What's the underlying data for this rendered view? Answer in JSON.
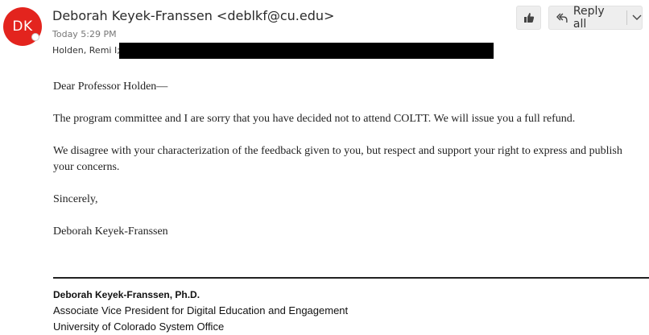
{
  "header": {
    "avatar_initials": "DK",
    "sender": "Deborah Keyek-Franssen <deblkf@cu.edu>",
    "timestamp": "Today 5:29 PM",
    "recipients": "Holden, Remi I;",
    "avatar_color": "#e3241e"
  },
  "actions": {
    "like_icon": "thumbs-up-icon",
    "reply_all_label": "Reply all",
    "reply_all_icon": "reply-all-icon",
    "dropdown_icon": "chevron-down-icon"
  },
  "message": {
    "greeting": "Dear Professor Holden—",
    "paragraph_1": "The program committee and I are sorry that you have decided not to attend COLTT. We will issue you a full refund.",
    "paragraph_2": "We disagree with your characterization of the feedback given to you, but respect and support your right to express and publish your concerns.",
    "closing": "Sincerely,",
    "signoff": "Deborah Keyek-Franssen"
  },
  "signature": {
    "name": "Deborah Keyek-Franssen, Ph.D.",
    "title": "Associate Vice President for Digital Education and Engagement",
    "organization": "University of Colorado System Office"
  }
}
